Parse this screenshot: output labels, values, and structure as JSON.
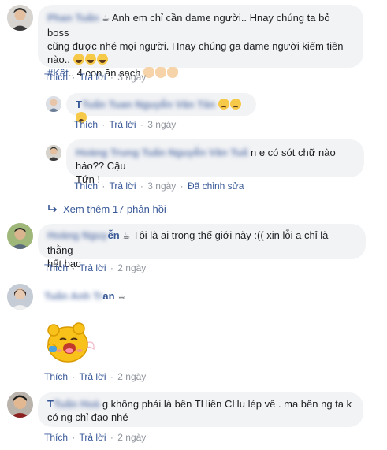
{
  "comments": [
    {
      "name_blurred": "Phan Tuấn",
      "name_tail": "",
      "text_line1": "Anh em chỉ cần dame người.. Hnay chúng ta bỏ boss",
      "text_line2": "cũng được nhé mọi người. Hnay chúng ga dame người kiếm tiền",
      "text_line3": "nào..",
      "hashtag": "#Kết",
      "text_line4": ".. 4 con ăn sạch",
      "actions": {
        "like": "Thích",
        "reply": "Trả lời",
        "time": "3 ngày"
      }
    },
    {
      "name_blurred": "Tuấn Tuan Nguyễn Văn Tân",
      "name_tail": "",
      "text": "",
      "actions": {
        "like": "Thích",
        "reply": "Trả lời",
        "time": "3 ngày"
      }
    },
    {
      "name_blurred": "Hoàng Trung Tuấn Nguyễn Văn Tuấ",
      "name_tail": "",
      "text_line1": "n e có sót chữ nào hảo?? Cậu",
      "text_line2": "Tứn !",
      "actions": {
        "like": "Thích",
        "reply": "Trả lời",
        "time": "3 ngày",
        "edited": "Đã chỉnh sửa"
      }
    },
    {
      "name_blurred": "Hoàng Nguy",
      "name_tail": "ễn",
      "text_line1": "Tôi là ai trong thế giới này :(( xin lỗi a chỉ là thằng",
      "text_line2": "hết bạc",
      "actions": {
        "like": "Thích",
        "reply": "Trả lời",
        "time": "2 ngày"
      }
    },
    {
      "name_blurred": "Tuấn Anh Tr",
      "name_tail": "an",
      "actions": {
        "like": "Thích",
        "reply": "Trả lời",
        "time": "2 ngày"
      }
    },
    {
      "name_blurred": "Tuấn Hoà",
      "name_tail": "",
      "text_line1": "g không phải là bên THiên CHu lép vế . ma bên ng ta k",
      "text_line2": "có ng chỉ đạo nhé",
      "actions": {
        "like": "Thích",
        "reply": "Trả lời",
        "time": "2 ngày"
      }
    }
  ],
  "first_name_initial": "T",
  "last_name_initial": "T",
  "see_more": "Xem thêm 17 phản hồi",
  "coffee_glyph": "☕",
  "separator": "·",
  "colors": {
    "link": "#385898",
    "meta": "#90949c",
    "bubble": "#f2f3f5",
    "text": "#1c1e21"
  }
}
